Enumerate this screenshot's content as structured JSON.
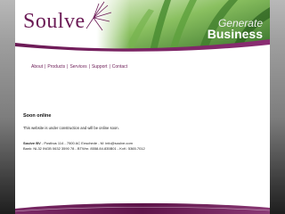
{
  "header": {
    "logo_text": "Soulve",
    "slogan_top": "Generate",
    "slogan_bottom": "Business"
  },
  "nav": {
    "items": [
      {
        "label": "About"
      },
      {
        "label": "Products"
      },
      {
        "label": "Services"
      },
      {
        "label": "Support"
      },
      {
        "label": "Contact"
      }
    ],
    "separator": "|"
  },
  "content": {
    "title": "Soon online",
    "text": "This website is under construction and will be online soon."
  },
  "footer": {
    "company": "Soulve BV",
    "address": " - Postbus 114 - 7500 AC Enschede - M: info@soulve.com",
    "bank": "Bank: NL32 INGB 0632 3590 78 - BTWnr. 8558.84.835B01 - KvK: 5365.7012"
  },
  "colors": {
    "brand": "#6b1a55",
    "accent_green": "#7ab648"
  }
}
